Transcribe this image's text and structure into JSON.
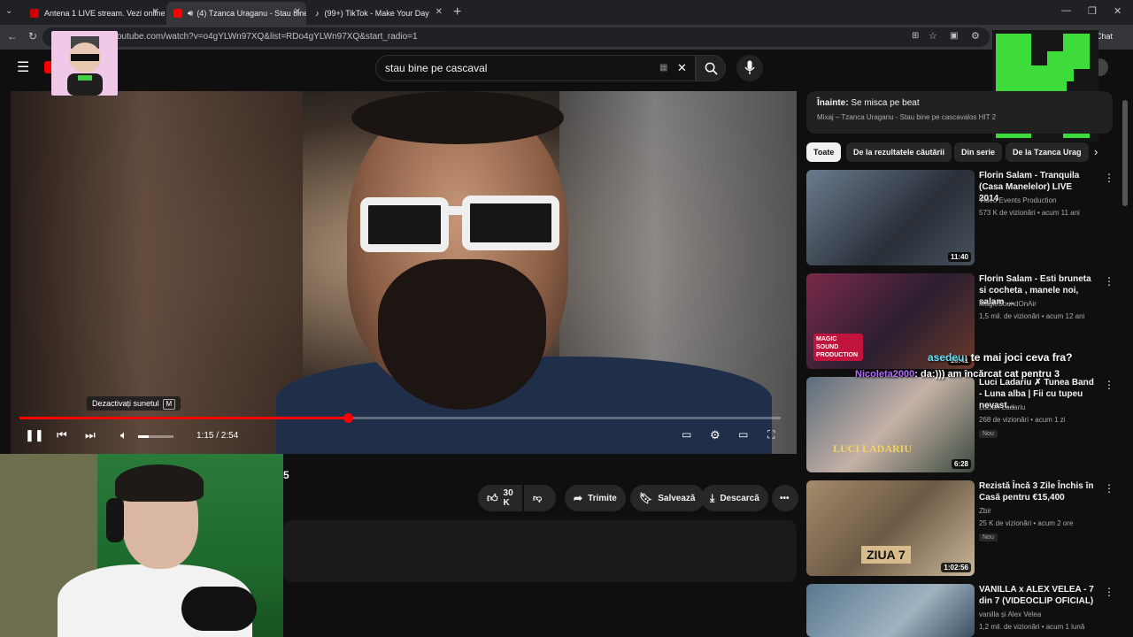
{
  "browser": {
    "tabs": [
      {
        "label": "Antena 1 LIVE stream. Vezi online",
        "active": false
      },
      {
        "label": "(4) Tzanca Uraganu - Stau bine",
        "active": true
      },
      {
        "label": "(99+) TikTok - Make Your Day",
        "active": false
      }
    ],
    "url": "outube.com/watch?v=o4gYLWn97XQ&list=RDo4gYLWn97XQ&start_radio=1",
    "chat_label": "Chat"
  },
  "youtube": {
    "search_value": "stau bine pe cascaval"
  },
  "player": {
    "tooltip": "Dezactivați sunetul",
    "tooltip_key": "M",
    "time": "1:15 / 2:54",
    "progress_fraction": 0.431,
    "volume_fraction": 0.3
  },
  "actions": {
    "likes": "30 K",
    "share": "Trimite",
    "save": "Salvează",
    "download": "Descarcă",
    "title_fragment": "5"
  },
  "sidebar": {
    "up_next_prefix": "Înainte:",
    "up_next_title": "Se misca pe beat",
    "up_next_sub": "Mixaj – Tzanca Uraganu - Stau bine pe cascavalos HIT 2",
    "chips": [
      "Toate",
      "De la rezultatele căutării",
      "Din serie",
      "De la Tzanca Urag"
    ],
    "videos": [
      {
        "title": "Florin Salam - Tranquila (Casa Manelelor) LIVE 2014",
        "channel": "Video Events Production",
        "meta": "573 K de vizionări • acum 11 ani",
        "duration": "11:40",
        "badge": ""
      },
      {
        "title": "Florin Salam - Esti bruneta si cocheta , manele noi, salam ...",
        "channel": "MagicSoundOnAir",
        "meta": "1,5 mil. de vizionări • acum 12 ani",
        "duration": "10:41",
        "badge": ""
      },
      {
        "title": "Luci Ladariu ✗ Tunea Band - Luna alba | Fii cu tupeu nevast...",
        "channel": "Lucian Ladariu",
        "meta": "268 de vizionări • acum 1 zi",
        "duration": "6:28",
        "badge": "Nou"
      },
      {
        "title": "Rezistă Încă 3 Zile Închis în Casă pentru €15,400",
        "channel": "Zbir",
        "meta": "25 K de vizionări • acum 2 ore",
        "duration": "1:02:56",
        "badge": "Nou"
      },
      {
        "title": "VANILLA x ALEX VELEA - 7 din 7 (VIDEOCLIP OFICIAL)",
        "channel": "vanilla și Alex Velea",
        "meta": "1,2 mil. de vizionări • acum 1 lună",
        "duration": "",
        "badge": ""
      }
    ],
    "thumb_texts": [
      "MAGIC SOUND PRODUCTION",
      "LUCI LADARIU",
      "ZIUA 7"
    ]
  },
  "chat_overlay": {
    "user1": "asedeu",
    "msg1": "te mai joci ceva fra?",
    "user2": "Nicoleta2000",
    "msg2": "da:))) am încărcat cat pentru 3"
  },
  "colors": {
    "accent": "#ff0000",
    "green": "#3ddc3a",
    "bg": "#0f0f0f"
  }
}
